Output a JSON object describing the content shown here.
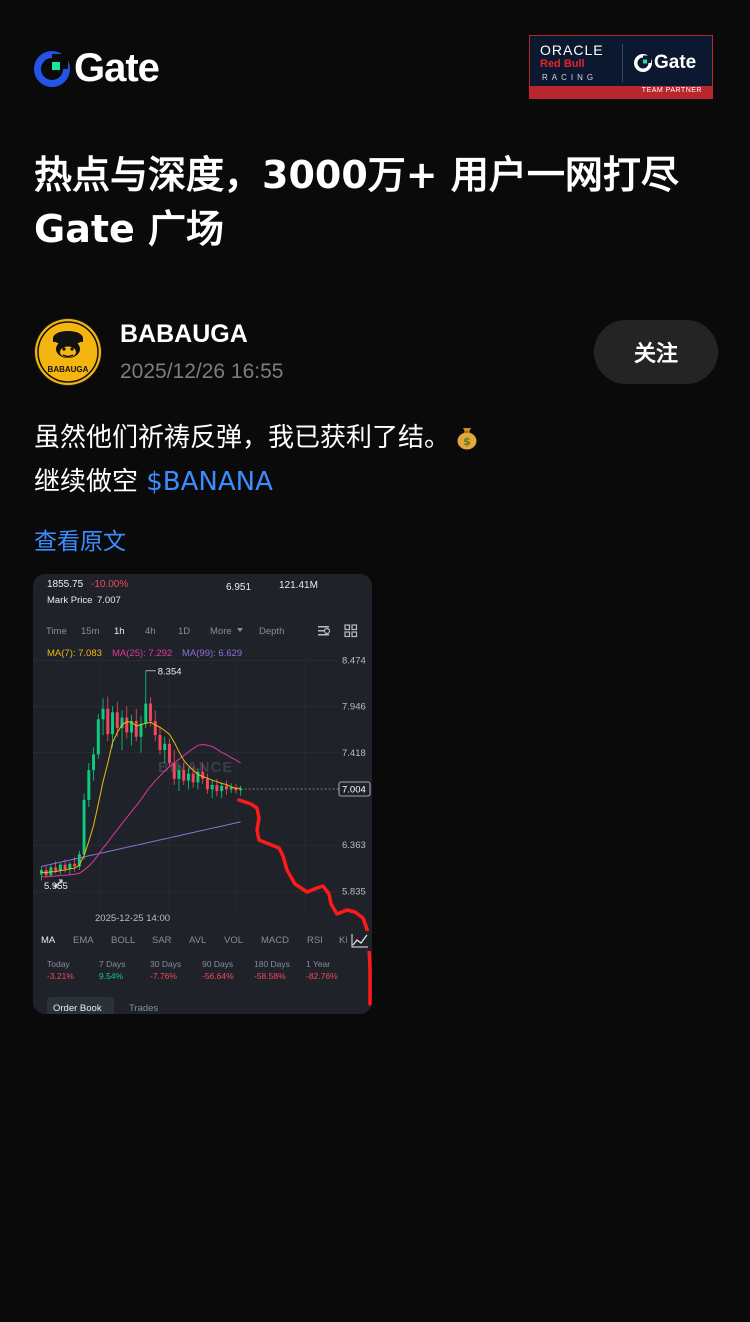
{
  "header": {
    "logo_text": "Gate",
    "partner": {
      "oracle": "ORACLE",
      "redbull": "Red Bull",
      "racing": "RACING",
      "gate": "Gate",
      "band": "TEAM PARTNER"
    }
  },
  "headline": {
    "line1": "热点与深度，3000万+ 用户一网打尽",
    "line2": "Gate 广场"
  },
  "author": {
    "name": "BABAUGA",
    "timestamp": "2025/12/26 16:55",
    "avatar_label": "BABAUGA",
    "follow_label": "关注"
  },
  "post": {
    "line1": "虽然他们祈祷反弹，我已获利了结。",
    "line2_prefix": "继续做空 ",
    "line2_tag": "$BANANA",
    "view_original": "查看原文"
  },
  "colors": {
    "background": "#0a0a0a",
    "link": "#3d8cff",
    "follow_button": "#242424",
    "chart_bg": "#1f2329",
    "up": "#0ecb81",
    "down": "#f6465d",
    "red_drawing": "#ff1a1a",
    "ma7": "#f0b90b",
    "ma25": "#e0379f",
    "ma99": "#8e6fd8"
  },
  "chart": {
    "top_left": "1855.75",
    "top_change": "-10.00%",
    "top_mid_value": "6.951",
    "top_right_value": "121.41M",
    "mark_price_label": "Mark Price",
    "mark_price_value": "7.007",
    "timeframes": [
      "Time",
      "15m",
      "1h",
      "4h",
      "1D",
      "More",
      "Depth"
    ],
    "active_timeframe": "1h",
    "ma_legend": {
      "ma7": "MA(7): 7.083",
      "ma25": "MA(25): 7.292",
      "ma99": "MA(99): 6.629"
    },
    "high_label": "8.354",
    "low_label": "5.955",
    "current_price": "7.004",
    "date_label": "2025-12-25 14:00",
    "watermark": "BINANCE",
    "indicators": [
      "MA",
      "EMA",
      "BOLL",
      "SAR",
      "AVL",
      "VOL",
      "MACD",
      "RSI",
      "KI"
    ],
    "performance": [
      {
        "label": "Today",
        "value": "-3.21%"
      },
      {
        "label": "7 Days",
        "value": "9.54%"
      },
      {
        "label": "30 Days",
        "value": "-7.76%"
      },
      {
        "label": "90 Days",
        "value": "-56.64%"
      },
      {
        "label": "180 Days",
        "value": "-58.58%"
      },
      {
        "label": "1 Year",
        "value": "-82.76%"
      }
    ],
    "bottom_tabs": [
      "Order Book",
      "Trades"
    ]
  },
  "chart_data": {
    "type": "candlestick",
    "title": "",
    "ylim": [
      5.6,
      8.5
    ],
    "y_ticks": [
      8.474,
      7.946,
      7.418,
      7.004,
      6.363,
      5.835
    ],
    "candles": [
      {
        "o": 6.03,
        "h": 6.12,
        "l": 5.96,
        "c": 6.08
      },
      {
        "o": 6.08,
        "h": 6.13,
        "l": 5.99,
        "c": 6.02
      },
      {
        "o": 6.02,
        "h": 6.15,
        "l": 6.0,
        "c": 6.11
      },
      {
        "o": 6.11,
        "h": 6.18,
        "l": 6.04,
        "c": 6.07
      },
      {
        "o": 6.07,
        "h": 6.16,
        "l": 6.03,
        "c": 6.14
      },
      {
        "o": 6.14,
        "h": 6.2,
        "l": 6.05,
        "c": 6.09
      },
      {
        "o": 6.09,
        "h": 6.17,
        "l": 6.02,
        "c": 6.15
      },
      {
        "o": 6.15,
        "h": 6.23,
        "l": 6.06,
        "c": 6.12
      },
      {
        "o": 6.12,
        "h": 6.3,
        "l": 6.08,
        "c": 6.26
      },
      {
        "o": 6.26,
        "h": 6.95,
        "l": 6.2,
        "c": 6.88
      },
      {
        "o": 6.88,
        "h": 7.3,
        "l": 6.8,
        "c": 7.22
      },
      {
        "o": 7.22,
        "h": 7.48,
        "l": 7.1,
        "c": 7.4
      },
      {
        "o": 7.4,
        "h": 7.86,
        "l": 7.35,
        "c": 7.8
      },
      {
        "o": 7.8,
        "h": 8.04,
        "l": 7.62,
        "c": 7.92
      },
      {
        "o": 7.92,
        "h": 8.06,
        "l": 7.55,
        "c": 7.63
      },
      {
        "o": 7.63,
        "h": 7.95,
        "l": 7.48,
        "c": 7.88
      },
      {
        "o": 7.88,
        "h": 8.0,
        "l": 7.6,
        "c": 7.7
      },
      {
        "o": 7.7,
        "h": 7.9,
        "l": 7.45,
        "c": 7.82
      },
      {
        "o": 7.82,
        "h": 7.95,
        "l": 7.58,
        "c": 7.65
      },
      {
        "o": 7.65,
        "h": 7.85,
        "l": 7.5,
        "c": 7.78
      },
      {
        "o": 7.78,
        "h": 7.92,
        "l": 7.55,
        "c": 7.6
      },
      {
        "o": 7.6,
        "h": 7.84,
        "l": 7.42,
        "c": 7.75
      },
      {
        "o": 7.75,
        "h": 8.354,
        "l": 7.7,
        "c": 7.98
      },
      {
        "o": 7.98,
        "h": 8.05,
        "l": 7.72,
        "c": 7.78
      },
      {
        "o": 7.78,
        "h": 7.9,
        "l": 7.55,
        "c": 7.62
      },
      {
        "o": 7.62,
        "h": 7.72,
        "l": 7.4,
        "c": 7.45
      },
      {
        "o": 7.45,
        "h": 7.6,
        "l": 7.3,
        "c": 7.52
      },
      {
        "o": 7.52,
        "h": 7.58,
        "l": 7.25,
        "c": 7.3
      },
      {
        "o": 7.3,
        "h": 7.45,
        "l": 7.05,
        "c": 7.12
      },
      {
        "o": 7.12,
        "h": 7.28,
        "l": 6.98,
        "c": 7.22
      },
      {
        "o": 7.22,
        "h": 7.3,
        "l": 7.05,
        "c": 7.1
      },
      {
        "o": 7.1,
        "h": 7.25,
        "l": 7.0,
        "c": 7.18
      },
      {
        "o": 7.18,
        "h": 7.26,
        "l": 7.02,
        "c": 7.08
      },
      {
        "o": 7.08,
        "h": 7.24,
        "l": 7.0,
        "c": 7.2
      },
      {
        "o": 7.2,
        "h": 7.3,
        "l": 7.06,
        "c": 7.12
      },
      {
        "o": 7.12,
        "h": 7.18,
        "l": 6.95,
        "c": 7.0
      },
      {
        "o": 7.0,
        "h": 7.1,
        "l": 6.9,
        "c": 7.05
      },
      {
        "o": 7.05,
        "h": 7.12,
        "l": 6.92,
        "c": 6.98
      },
      {
        "o": 6.98,
        "h": 7.08,
        "l": 6.9,
        "c": 7.04
      },
      {
        "o": 7.04,
        "h": 7.1,
        "l": 6.94,
        "c": 7.0
      },
      {
        "o": 7.0,
        "h": 7.07,
        "l": 6.96,
        "c": 7.02
      },
      {
        "o": 7.02,
        "h": 7.06,
        "l": 6.95,
        "c": 6.99
      },
      {
        "o": 6.99,
        "h": 7.04,
        "l": 6.93,
        "c": 7.004
      }
    ]
  }
}
